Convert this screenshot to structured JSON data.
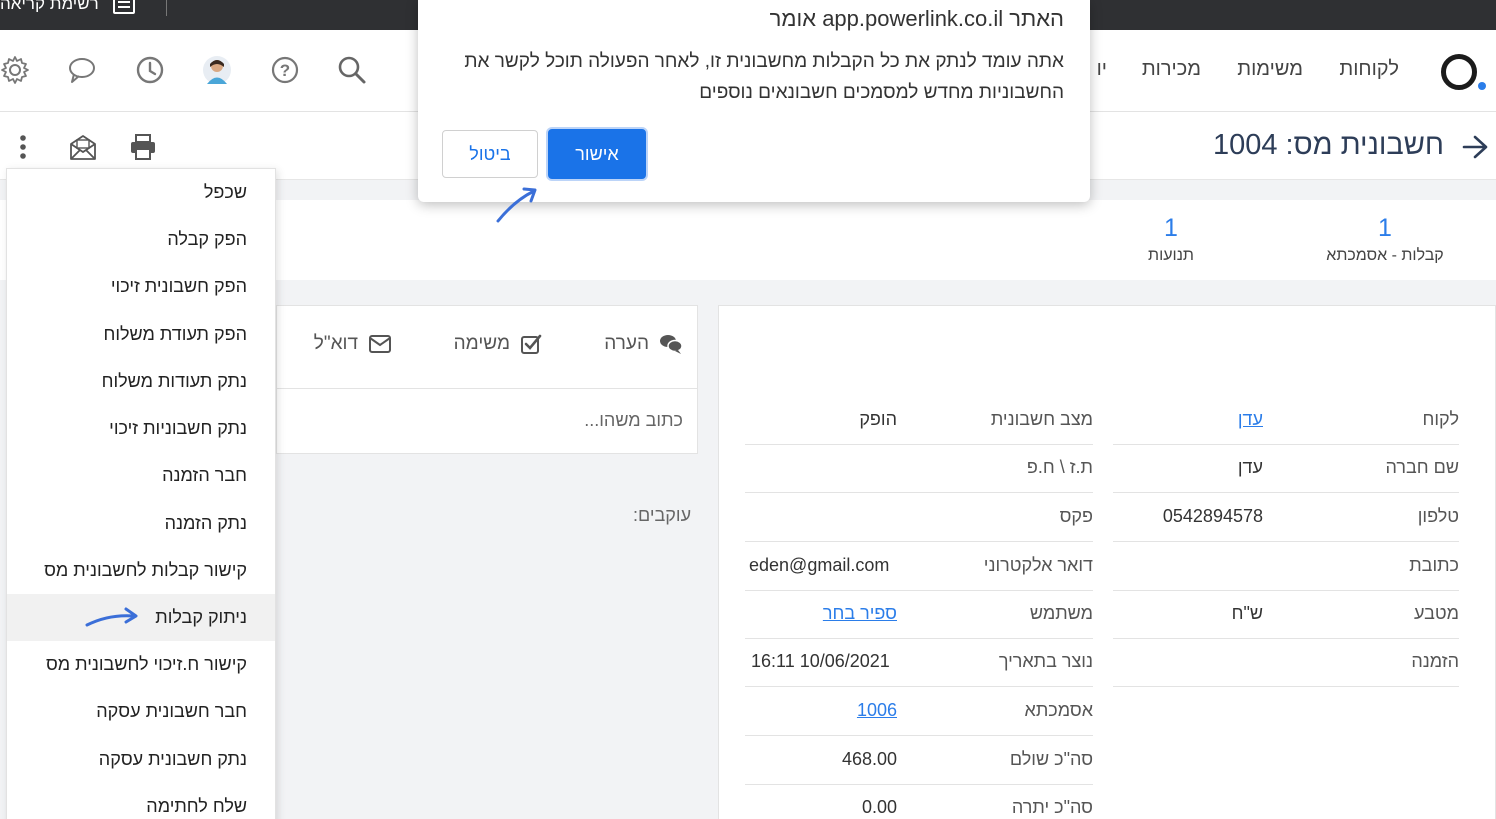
{
  "topbar": {
    "reading_list": "רשימת קריאה"
  },
  "nav": {
    "items": [
      "לקוחות",
      "משימות",
      "מכירות",
      "יו"
    ],
    "icons": [
      "search-icon",
      "help-icon",
      "avatar",
      "clock-icon",
      "chat-icon",
      "gear-icon"
    ]
  },
  "header": {
    "title": "חשבונית מס:  1004"
  },
  "stats": [
    {
      "num": "1",
      "label": "קבלות - אסמכתא"
    },
    {
      "num": "1",
      "label": "תנועות"
    }
  ],
  "activity": {
    "tabs": [
      "הערה",
      "משימה",
      "דוא\"ל"
    ],
    "placeholder": "כתוב משהו...",
    "followers": "עוקבים:"
  },
  "details": {
    "right_col": [
      {
        "label": "לקוח",
        "value": "עדן",
        "link": true
      },
      {
        "label": "שם חברה",
        "value": "עדן"
      },
      {
        "label": "טלפון",
        "value": "0542894578"
      },
      {
        "label": "כתובת",
        "value": ""
      },
      {
        "label": "מטבע",
        "value": "ש\"ח"
      },
      {
        "label": "הזמנה",
        "value": ""
      }
    ],
    "left_col": [
      {
        "label": "מצב חשבונית",
        "value": "הופק"
      },
      {
        "label": "ת.ז \\ ח.פ",
        "value": ""
      },
      {
        "label": "פקס",
        "value": ""
      },
      {
        "label": "דואר אלקטרוני",
        "value": "eden@gmail.com"
      },
      {
        "label": "משתמש",
        "value": "ספיר בחר",
        "link": true
      },
      {
        "label": "נוצר בתאריך",
        "value": "16:11 10/06/2021"
      },
      {
        "label": "אסמכתא",
        "value": "1006",
        "link": true
      },
      {
        "label": "סה\"כ שולם",
        "value": "468.00"
      },
      {
        "label": "סה\"כ יתרה",
        "value": "0.00"
      }
    ]
  },
  "menu": {
    "items": [
      "שכפל",
      "הפק קבלה",
      "הפק חשבונית זיכוי",
      "הפק תעודת משלוח",
      "נתק תעודות משלוח",
      "נתק חשבוניות זיכוי",
      "חבר הזמנה",
      "נתק הזמנה",
      "קישור קבלות לחשבונית מס",
      "ניתוק קבלות",
      "קישור ח.זיכוי לחשבונית מס",
      "חבר חשבונית עסקה",
      "נתק חשבונית עסקה",
      "שלח לחתימה"
    ],
    "highlighted_index": 9
  },
  "dialog": {
    "title": "האתר app.powerlink.co.il אומר",
    "message": "אתה עומד לנתק את כל הקבלות מחשבונית זו, לאחר הפעולה תוכל לקשר את החשבוניות מחדש למסמכים חשבונאים נוספים",
    "ok_label": "אישור",
    "cancel_label": "ביטול"
  },
  "colors": {
    "accent": "#1a73e8",
    "link": "#2b7de9",
    "title": "#2d3d58",
    "topbar": "#2f3033"
  }
}
